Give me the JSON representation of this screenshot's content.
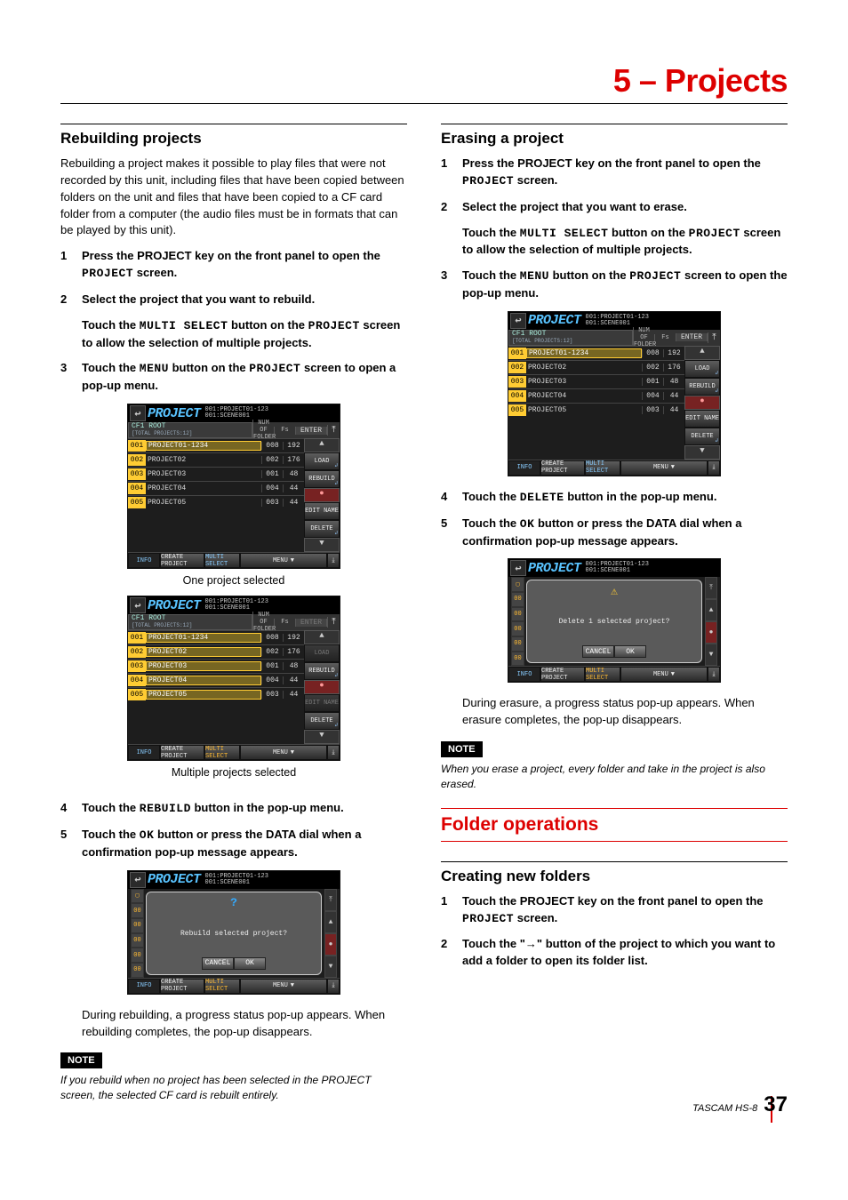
{
  "chapter": "5 – Projects",
  "left": {
    "h2": "Rebuilding projects",
    "intro": "Rebuilding a project makes it possible to play files that were not recorded by this unit, including files that have been copied between folders on the unit and files that have been copied to a CF card folder from a computer (the audio files must be in formats that can be played by this unit).",
    "steps": [
      {
        "n": "1",
        "t_a": "Press the ",
        "t_b": "PROJECT",
        "t_c": " key on the front panel to open the ",
        "t_d": "PROJECT",
        "t_e": " screen."
      },
      {
        "n": "2",
        "t_a": "Select the project that you want to rebuild.",
        "sub_a": "Touch the ",
        "sub_b": "MULTI SELECT",
        "sub_c": " button on the ",
        "sub_d": "PROJECT",
        "sub_e": " screen to allow the selection of multiple projects."
      },
      {
        "n": "3",
        "t_a": "Touch the ",
        "t_b": "MENU",
        "t_c": " button on the ",
        "t_d": "PROJECT",
        "t_e": " screen to open a pop-up menu."
      },
      {
        "n": "4",
        "t_a": "Touch the ",
        "t_b": "REBUILD",
        "t_c": " button in the pop-up menu."
      },
      {
        "n": "5",
        "t_a": "Touch the ",
        "t_b": "OK",
        "t_c": " button or press the ",
        "t_d": "DATA",
        "t_e": " dial when a confirmation pop-up message appears."
      }
    ],
    "caption1": "One project selected",
    "caption2": "Multiple projects selected",
    "afterdialog": "During rebuilding, a progress status pop-up appears. When rebuilding completes, the pop-up disappears.",
    "note_tag": "NOTE",
    "note": "If you rebuild when no project has been selected in the PROJECT screen, the selected CF card is rebuilt entirely."
  },
  "right": {
    "h2": "Erasing a project",
    "steps": [
      {
        "n": "1",
        "t_a": "Press the ",
        "t_b": "PROJECT",
        "t_c": " key on the front panel to open the ",
        "t_d": "PROJECT",
        "t_e": " screen."
      },
      {
        "n": "2",
        "t_a": "Select the project that you want to erase.",
        "sub_a": "Touch the ",
        "sub_b": "MULTI SELECT",
        "sub_c": " button on the ",
        "sub_d": "PROJECT",
        "sub_e": " screen to allow the selection of multiple projects."
      },
      {
        "n": "3",
        "t_a": "Touch the ",
        "t_b": "MENU",
        "t_c": " button on the ",
        "t_d": "PROJECT",
        "t_e": " screen to open the pop-up menu."
      },
      {
        "n": "4",
        "t_a": "Touch the ",
        "t_b": "DELETE",
        "t_c": " button in the pop-up menu."
      },
      {
        "n": "5",
        "t_a": "Touch the ",
        "t_b": "OK",
        "t_c": " button or press the ",
        "t_d": "DATA",
        "t_e": " dial when a confirmation pop-up message appears."
      }
    ],
    "afterdialog": "During erasure, a progress status pop-up appears. When erasure completes, the pop-up disappears.",
    "note_tag": "NOTE",
    "note": "When you erase a project, every folder and take in the project is also erased.",
    "h2_section": "Folder operations",
    "h2b": "Creating new folders",
    "steps_b": [
      {
        "n": "1",
        "t_a": "Touch the ",
        "t_b": "PROJECT",
        "t_c": " key on the front panel to open the ",
        "t_d": "PROJECT",
        "t_e": " screen."
      },
      {
        "n": "2",
        "t_a": "Touch the \"",
        "t_b": "→",
        "t_c": "\" button of the project to which you want to add a folder to open its folder list."
      }
    ]
  },
  "lcd_common": {
    "title": "PROJECT",
    "sub1": "001:PROJECT01-123",
    "sub2": "001:SCENE001",
    "root1": "CF1 ROOT",
    "root2": "[TOTAL PROJECTS:12]",
    "hcol1": "NUM OF FOLDER",
    "hcol2": "Fs",
    "enter": "ENTER",
    "info": "INFO",
    "create": "CREATE PROJECT",
    "multi": "MULTI SELECT",
    "menu": "MENU",
    "menu_load": "LOAD",
    "menu_rebuild": "REBUILD",
    "menu_edit": "EDIT NAME",
    "menu_delete": "DELETE",
    "rows": [
      {
        "idx": "001",
        "name": "PROJECT01-1234",
        "a": "008",
        "b": "192"
      },
      {
        "idx": "002",
        "name": "PROJECT02",
        "a": "002",
        "b": "176"
      },
      {
        "idx": "003",
        "name": "PROJECT03",
        "a": "001",
        "b": "48"
      },
      {
        "idx": "004",
        "name": "PROJECT04",
        "a": "004",
        "b": "44"
      },
      {
        "idx": "005",
        "name": "PROJECT05",
        "a": "003",
        "b": "44"
      }
    ]
  },
  "dialog_rebuild": {
    "msg": "Rebuild selected project?",
    "cancel": "CANCEL",
    "ok": "OK"
  },
  "dialog_delete": {
    "msg": "Delete 1 selected project?",
    "cancel": "CANCEL",
    "ok": "OK"
  },
  "footer": {
    "brand": "TASCAM  HS-8",
    "page": "37"
  }
}
